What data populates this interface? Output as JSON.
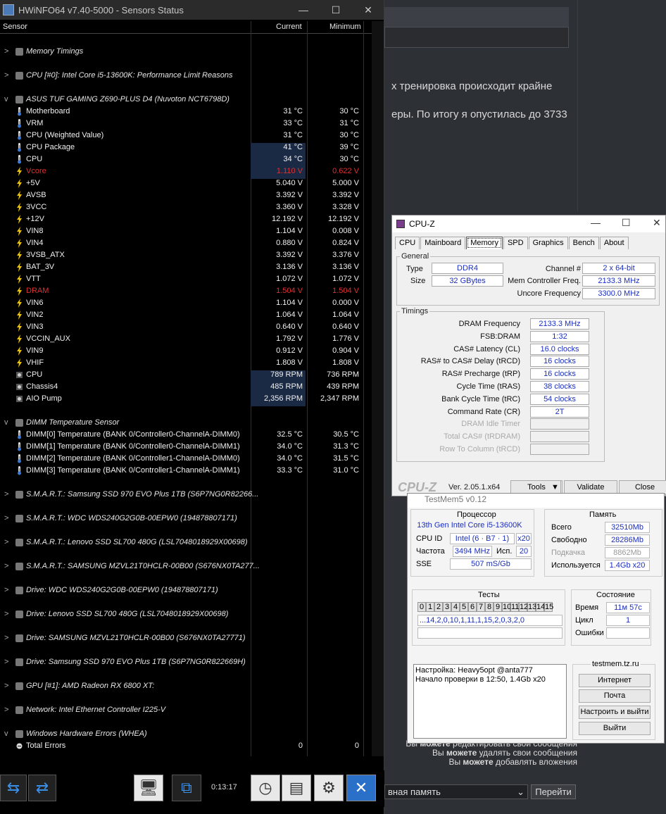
{
  "background": {
    "line1": "х тренировка происходит крайне",
    "line2": "еры. По итогу я опустилась до 3733",
    "perm1": [
      "Вы ",
      "можете",
      " редактировать свои сообщения"
    ],
    "perm2": [
      "Вы ",
      "можете",
      " удалять свои сообщения"
    ],
    "perm3": [
      "Вы ",
      "можете",
      " добавлять вложения"
    ],
    "select_value": "вная память",
    "go_button": "Перейти"
  },
  "hwinfo": {
    "title": "HWiNFO64 v7.40-5000 - Sensors Status",
    "col_sensor": "Sensor",
    "col_current": "Current",
    "col_minimum": "Minimum",
    "elapsed": "0:13:17",
    "rows": [
      {
        "type": "gap"
      },
      {
        "type": "group",
        "label": "Memory Timings",
        "exp": ">"
      },
      {
        "type": "gap"
      },
      {
        "type": "group",
        "label": "CPU [#0]: Intel Core i5-13600K: Performance Limit Reasons",
        "exp": ">"
      },
      {
        "type": "gap"
      },
      {
        "type": "group",
        "label": "ASUS TUF GAMING Z690-PLUS D4 (Nuvoton NCT6798D)",
        "exp": "v"
      },
      {
        "type": "s",
        "icon": "temp",
        "label": "Motherboard",
        "cur": "31 °C",
        "min": "30 °C"
      },
      {
        "type": "s",
        "icon": "temp",
        "label": "VRM",
        "cur": "33 °C",
        "min": "31 °C"
      },
      {
        "type": "s",
        "icon": "temp",
        "label": "CPU (Weighted Value)",
        "cur": "31 °C",
        "min": "30 °C"
      },
      {
        "type": "s",
        "icon": "temp",
        "label": "CPU Package",
        "cur": "41 °C",
        "min": "39 °C",
        "hl": true
      },
      {
        "type": "s",
        "icon": "temp",
        "label": "CPU",
        "cur": "34 °C",
        "min": "30 °C",
        "hl": true
      },
      {
        "type": "s",
        "icon": "volt",
        "label": "Vcore",
        "cur": "1.110 V",
        "min": "0.622 V",
        "hl": true,
        "red": true
      },
      {
        "type": "s",
        "icon": "volt",
        "label": "+5V",
        "cur": "5.040 V",
        "min": "5.000 V"
      },
      {
        "type": "s",
        "icon": "volt",
        "label": "AVSB",
        "cur": "3.392 V",
        "min": "3.392 V"
      },
      {
        "type": "s",
        "icon": "volt",
        "label": "3VCC",
        "cur": "3.360 V",
        "min": "3.328 V"
      },
      {
        "type": "s",
        "icon": "volt",
        "label": "+12V",
        "cur": "12.192 V",
        "min": "12.192 V"
      },
      {
        "type": "s",
        "icon": "volt",
        "label": "VIN8",
        "cur": "1.104 V",
        "min": "0.008 V"
      },
      {
        "type": "s",
        "icon": "volt",
        "label": "VIN4",
        "cur": "0.880 V",
        "min": "0.824 V"
      },
      {
        "type": "s",
        "icon": "volt",
        "label": "3VSB_ATX",
        "cur": "3.392 V",
        "min": "3.376 V"
      },
      {
        "type": "s",
        "icon": "volt",
        "label": "BAT_3V",
        "cur": "3.136 V",
        "min": "3.136 V"
      },
      {
        "type": "s",
        "icon": "volt",
        "label": "VTT",
        "cur": "1.072 V",
        "min": "1.072 V"
      },
      {
        "type": "s",
        "icon": "volt",
        "label": "DRAM",
        "cur": "1.504 V",
        "min": "1.504 V",
        "red": true
      },
      {
        "type": "s",
        "icon": "volt",
        "label": "VIN6",
        "cur": "1.104 V",
        "min": "0.000 V"
      },
      {
        "type": "s",
        "icon": "volt",
        "label": "VIN2",
        "cur": "1.064 V",
        "min": "1.064 V"
      },
      {
        "type": "s",
        "icon": "volt",
        "label": "VIN3",
        "cur": "0.640 V",
        "min": "0.640 V"
      },
      {
        "type": "s",
        "icon": "volt",
        "label": "VCCIN_AUX",
        "cur": "1.792 V",
        "min": "1.776 V"
      },
      {
        "type": "s",
        "icon": "volt",
        "label": "VIN9",
        "cur": "0.912 V",
        "min": "0.904 V"
      },
      {
        "type": "s",
        "icon": "volt",
        "label": "VHIF",
        "cur": "1.808 V",
        "min": "1.808 V"
      },
      {
        "type": "s",
        "icon": "fan",
        "label": "CPU",
        "cur": "789 RPM",
        "min": "736 RPM",
        "hl": true
      },
      {
        "type": "s",
        "icon": "fan",
        "label": "Chassis4",
        "cur": "485 RPM",
        "min": "439 RPM",
        "hl": true
      },
      {
        "type": "s",
        "icon": "fan",
        "label": "AIO Pump",
        "cur": "2,356 RPM",
        "min": "2,347 RPM",
        "hl": true
      },
      {
        "type": "gap"
      },
      {
        "type": "group",
        "label": "DIMM Temperature Sensor",
        "exp": "v"
      },
      {
        "type": "s",
        "icon": "temp",
        "label": "DIMM[0] Temperature (BANK 0/Controller0-ChannelA-DIMM0)",
        "cur": "32.5 °C",
        "min": "30.5 °C"
      },
      {
        "type": "s",
        "icon": "temp",
        "label": "DIMM[1] Temperature (BANK 0/Controller0-ChannelA-DIMM1)",
        "cur": "34.0 °C",
        "min": "31.3 °C"
      },
      {
        "type": "s",
        "icon": "temp",
        "label": "DIMM[2] Temperature (BANK 0/Controller1-ChannelA-DIMM0)",
        "cur": "34.0 °C",
        "min": "31.5 °C"
      },
      {
        "type": "s",
        "icon": "temp",
        "label": "DIMM[3] Temperature (BANK 0/Controller1-ChannelA-DIMM1)",
        "cur": "33.3 °C",
        "min": "31.0 °C"
      },
      {
        "type": "gap"
      },
      {
        "type": "group",
        "label": "S.M.A.R.T.: Samsung SSD 970 EVO Plus 1TB (S6P7NG0R82266...",
        "exp": ">"
      },
      {
        "type": "gap"
      },
      {
        "type": "group",
        "label": "S.M.A.R.T.: WDC WDS240G2G0B-00EPW0 (194878807171)",
        "exp": ">"
      },
      {
        "type": "gap"
      },
      {
        "type": "group",
        "label": "S.M.A.R.T.: Lenovo SSD SL700 480G (LSL7048018929X00698)",
        "exp": ">"
      },
      {
        "type": "gap"
      },
      {
        "type": "group",
        "label": "S.M.A.R.T.: SAMSUNG MZVL21T0HCLR-00B00 (S676NX0TA277...",
        "exp": ">"
      },
      {
        "type": "gap"
      },
      {
        "type": "group",
        "label": "Drive: WDC WDS240G2G0B-00EPW0 (194878807171)",
        "exp": ">"
      },
      {
        "type": "gap"
      },
      {
        "type": "group",
        "label": "Drive: Lenovo SSD SL700 480G (LSL7048018929X00698)",
        "exp": ">"
      },
      {
        "type": "gap"
      },
      {
        "type": "group",
        "label": "Drive: SAMSUNG MZVL21T0HCLR-00B00 (S676NX0TA27771)",
        "exp": ">"
      },
      {
        "type": "gap"
      },
      {
        "type": "group",
        "label": "Drive: Samsung SSD 970 EVO Plus 1TB (S6P7NG0R822669H)",
        "exp": ">"
      },
      {
        "type": "gap"
      },
      {
        "type": "group",
        "label": "GPU [#1]: AMD Radeon RX 6800 XT:",
        "exp": ">"
      },
      {
        "type": "gap"
      },
      {
        "type": "group",
        "label": "Network: Intel Ethernet Controller I225-V",
        "exp": ">"
      },
      {
        "type": "gap"
      },
      {
        "type": "group",
        "label": "Windows Hardware Errors (WHEA)",
        "exp": "v"
      },
      {
        "type": "s",
        "icon": "err",
        "label": "Total Errors",
        "cur": "0",
        "min": "0"
      }
    ]
  },
  "cpuz": {
    "title": "CPU-Z",
    "tabs": [
      "CPU",
      "Mainboard",
      "Memory",
      "SPD",
      "Graphics",
      "Bench",
      "About"
    ],
    "active_tab": "Memory",
    "general_legend": "General",
    "type_label": "Type",
    "type_value": "DDR4",
    "size_label": "Size",
    "size_value": "32 GBytes",
    "channel_label": "Channel #",
    "channel_value": "2 x 64-bit",
    "mcf_label": "Mem Controller Freq.",
    "mcf_value": "2133.3 MHz",
    "uncore_label": "Uncore Frequency",
    "uncore_value": "3300.0 MHz",
    "timings_legend": "Timings",
    "timings": [
      {
        "label": "DRAM Frequency",
        "value": "2133.3 MHz"
      },
      {
        "label": "FSB:DRAM",
        "value": "1:32"
      },
      {
        "label": "CAS# Latency (CL)",
        "value": "16.0 clocks"
      },
      {
        "label": "RAS# to CAS# Delay (tRCD)",
        "value": "16 clocks"
      },
      {
        "label": "RAS# Precharge (tRP)",
        "value": "16 clocks"
      },
      {
        "label": "Cycle Time (tRAS)",
        "value": "38 clocks"
      },
      {
        "label": "Bank Cycle Time (tRC)",
        "value": "54 clocks"
      },
      {
        "label": "Command Rate (CR)",
        "value": "2T"
      },
      {
        "label": "DRAM Idle Timer",
        "value": "",
        "dim": true
      },
      {
        "label": "Total CAS# (tRDRAM)",
        "value": "",
        "dim": true
      },
      {
        "label": "Row To Column (tRCD)",
        "value": "",
        "dim": true
      }
    ],
    "logo": "CPU-Z",
    "version": "Ver. 2.05.1.x64",
    "tools": "Tools",
    "validate": "Validate",
    "close": "Close"
  },
  "testmem": {
    "title": "TestMem5 v0.12",
    "cpu_legend": "Процессор",
    "cpu_name": "13th Gen Intel Core i5-13600K",
    "cpuid_label": "CPU ID",
    "cpuid_value": "Intel  (6 · B7 · 1)",
    "cpuid_x": "x20",
    "freq_label": "Частота",
    "freq_value": "3494 MHz",
    "used_label": "Исп.",
    "used_value": "20",
    "sse_label": "SSE",
    "sse_value": "507 mS/Gb",
    "mem_legend": "Память",
    "total_label": "Всего",
    "total_value": "32510Mb",
    "free_label": "Свободно",
    "free_value": "28286Mb",
    "swap_label": "Подкачка",
    "swap_value": "8862Mb",
    "inuse_label": "Используется",
    "inuse_value": "1.4Gb x20",
    "tests_legend": "Тесты",
    "test_cells": [
      "0",
      "1",
      "2",
      "3",
      "4",
      "5",
      "6",
      "7",
      "8",
      "9",
      "10",
      "11",
      "12",
      "13",
      "14",
      "15"
    ],
    "sequence": "...14,2,0,10,1,11,1,15,2,0,3,2,0",
    "state_legend": "Состояние",
    "time_label": "Время",
    "time_value": "11м 57с",
    "cycle_label": "Цикл",
    "cycle_value": "1",
    "errors_label": "Ошибки",
    "errors_value": "",
    "log_line1": "Настройка: Heavy5opt @anta777",
    "log_line2": "Начало проверки в 12:50, 1.4Gb x20",
    "site_legend": "testmem.tz.ru",
    "btn_internet": "Интернет",
    "btn_mail": "Почта",
    "btn_setup": "Настроить и выйти",
    "btn_exit": "Выйти"
  }
}
